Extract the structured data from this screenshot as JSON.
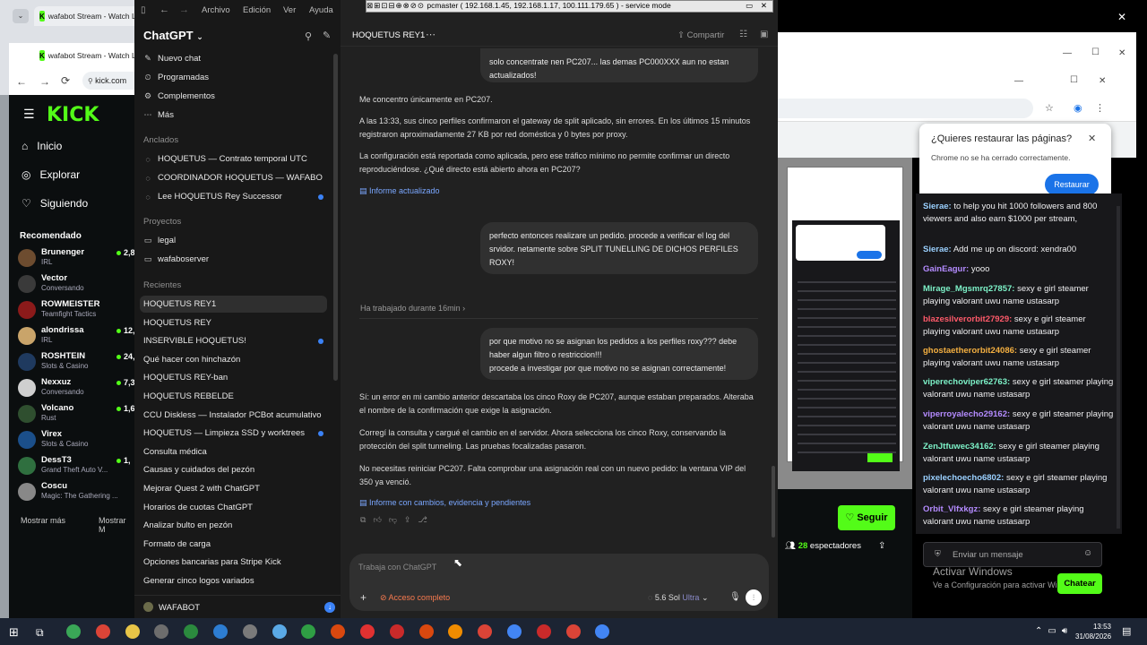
{
  "left_browser": {
    "tab1": "wafabot Stream - Watch L",
    "tab2": "wafabot Stream - Watch L",
    "url": "kick.com",
    "nav": {
      "home": "Inicio",
      "explore": "Explorar",
      "following": "Siguiendo"
    },
    "recommended_label": "Recomendado",
    "channels": [
      {
        "name": "Brunenger",
        "game": "IRL",
        "viewers": "2,8"
      },
      {
        "name": "Vector",
        "game": "Conversando",
        "viewers": ""
      },
      {
        "name": "ROWMEISTER",
        "game": "Teamfight Tactics",
        "viewers": ""
      },
      {
        "name": "alondrissa",
        "game": "IRL",
        "viewers": "12,6"
      },
      {
        "name": "ROSHTEIN",
        "game": "Slots & Casino",
        "viewers": "24,6"
      },
      {
        "name": "Nexxuz",
        "game": "Conversando",
        "viewers": "7,3"
      },
      {
        "name": "Volcano",
        "game": "Rust",
        "viewers": "1,6"
      },
      {
        "name": "Virex",
        "game": "Slots & Casino",
        "viewers": ""
      },
      {
        "name": "DessT3",
        "game": "Grand Theft Auto V...",
        "viewers": "1,"
      },
      {
        "name": "Coscu",
        "game": "Magic: The Gathering ...",
        "viewers": ""
      }
    ],
    "show_more_1": "Mostrar más",
    "show_more_2": "Mostrar M"
  },
  "remote": {
    "title": "pcmaster ( 192.168.1.45, 192.168.1.17, 100.111.179.65 ) - service mode"
  },
  "chatgpt": {
    "menu": [
      "Archivo",
      "Edición",
      "Ver",
      "Ayuda"
    ],
    "brand": "ChatGPT",
    "top_items": [
      "Nuevo chat",
      "Programadas",
      "Complementos",
      "Más"
    ],
    "pinned_label": "Anclados",
    "pinned": [
      "HOQUETUS — Contrato temporal UTC",
      "COORDINADOR HOQUETUS — WAFABO",
      "Lee HOQUETUS Rey Successor"
    ],
    "projects_label": "Proyectos",
    "projects": [
      "legal",
      "wafaboserver"
    ],
    "recent_label": "Recientes",
    "recent": [
      "HOQUETUS REY1",
      "HOQUETUS REY",
      "INSERVIBLE HOQUETUS!",
      "Qué hacer con hinchazón",
      "HOQUETUS REY-ban",
      "HOQUETUS REBELDE",
      "CCU Diskless — Instalador PCBot acumulativo",
      "HOQUETUS — Limpieza SSD y worktrees",
      "Consulta médica",
      "Causas y cuidados del pezón",
      "Mejorar Quest 2 with ChatGPT",
      "Horarios de cuotas ChatGPT",
      "Analizar bulto en pezón",
      "Formato de carga",
      "Opciones bancarias para Stripe Kick",
      "Generar cinco logos variados"
    ],
    "user": "WAFABOT",
    "conv_title": "HOQUETUS REY1",
    "share": "Compartir",
    "bubble1": "solo concentrate nen PC207... las demas  PC000XXX aun no estan actualizados!",
    "p1": "Me concentro únicamente en PC207.",
    "p2": "A las 13:33, sus cinco perfiles confirmaron el gateway de split aplicado, sin errores. En los últimos 15 minutos registraron aproximadamente 27 KB por red doméstica y 0 bytes por proxy.",
    "p3": "La configuración está reportada como aplicada, pero ese tráfico mínimo no permite confirmar un directo reproduciéndose. ¿Qué directo está abierto ahora en PC207?",
    "link1": "Informe actualizado",
    "bubble2": "perfecto entonces realizare un pedido. procede a verificar el log del srvidor. netamente sobre SPLIT TUNELLING DE DICHOS PERFILES ROXY!",
    "worked": "Ha trabajado durante 16min",
    "bubble3a": "por que motivo no se asignan los pedidos a los perfiles roxy??? debe haber algun filtro o  restriccion!!!",
    "bubble3b": "procede a investigar por que motivo no se asignan correctamente!",
    "p4": "Sí: un error en mi cambio anterior descartaba los cinco Roxy de PC207, aunque estaban preparados. Alteraba el nombre de la confirmación que exige la asignación.",
    "p5": "Corregí la consulta y cargué el cambio en el servidor. Ahora selecciona los cinco Roxy, conservando la protección del split tunneling. Las pruebas focalizadas pasaron.",
    "p6": "No necesitas reiniciar PC207. Falta comprobar una asignación real con un nuevo pedido: la ventana VIP del 350 ya venció.",
    "link2": "Informe con cambios, evidencia y pendientes",
    "input_placeholder": "Trabaja con ChatGPT",
    "access": "Acceso completo",
    "model": "5.6 Sol",
    "model_tier": "Ultra"
  },
  "right_browser": {
    "dialog_title": "¿Quieres restaurar las páginas?",
    "dialog_body": "Chrome no se ha cerrado correctamente.",
    "dialog_button": "Restaurar",
    "messages": [
      {
        "user": "Sierae:",
        "text": "to help you hit 1000 followers and 800 viewers and also earn $1000 per stream,",
        "color": "#9ad0ff"
      },
      {
        "user": "Sierae:",
        "text": "Add me up on discord: xendra00",
        "color": "#9ad0ff"
      },
      {
        "user": "GainEagur:",
        "text": "yooo",
        "color": "#b48bff"
      },
      {
        "user": "Mirage_Mgsmrq27857:",
        "text": "sexy e girl steamer playing valorant uwu name ustasarp",
        "color": "#7df2c8"
      },
      {
        "user": "blazesilverorbit27929:",
        "text": "sexy e girl steamer playing valorant uwu name ustasarp",
        "color": "#ff5a6a"
      },
      {
        "user": "ghostaetherorbit24086:",
        "text": "sexy e girl steamer playing valorant uwu name ustasarp",
        "color": "#f5b041"
      },
      {
        "user": "viperechoviper62763:",
        "text": "sexy e girl steamer playing valorant uwu name ustasarp",
        "color": "#7df2c8"
      },
      {
        "user": "viperroyalecho29162:",
        "text": "sexy e girl steamer playing valorant uwu name ustasarp",
        "color": "#b48bff"
      },
      {
        "user": "ZenJtfuwec34162:",
        "text": "sexy e girl steamer playing valorant uwu name ustasarp",
        "color": "#7df2c8"
      },
      {
        "user": "pixelechoecho6802:",
        "text": "sexy e girl steamer playing valorant uwu name ustasarp",
        "color": "#9ad0ff"
      },
      {
        "user": "Orbit_VIfxkgz:",
        "text": "sexy e girl steamer playing valorant uwu name ustasarp",
        "color": "#b48bff"
      }
    ],
    "follow": "Seguir",
    "viewers": "28",
    "viewers_label": "espectadores",
    "send_placeholder": "Enviar un mensaje",
    "chat_button": "Chatear",
    "activate_title": "Activar Windows",
    "activate_body": "Ve a Configuración para activar Windows."
  },
  "taskbar": {
    "time": "13:53",
    "date": "31/08/2026"
  }
}
